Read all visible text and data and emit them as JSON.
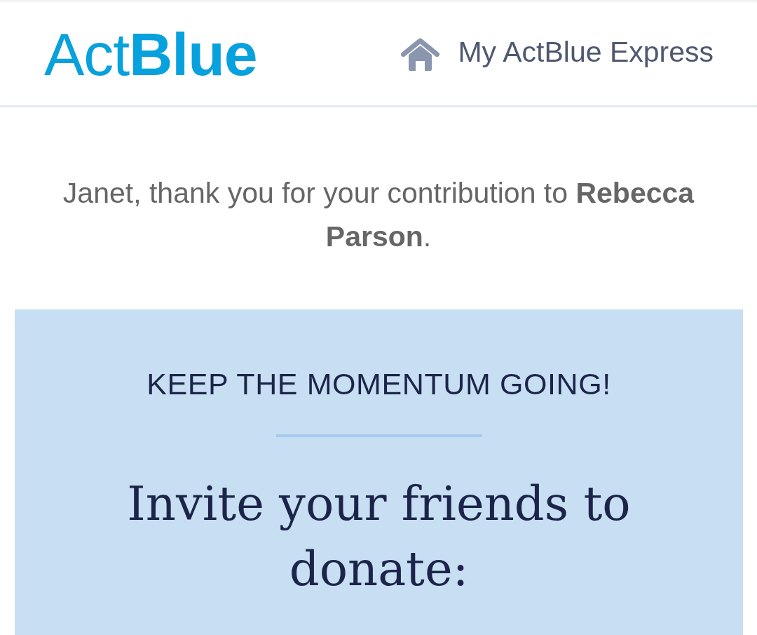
{
  "header": {
    "logo": "Act**Blue**",
    "nav_link": {
      "label": "My ActBlue Express"
    }
  },
  "thank_you": "Janet, thank you for your contribution to **Rebecca Parson**.",
  "promo": {
    "eyebrow": "KEEP THE MOMENTUM GOING!",
    "heading": "Invite your friends to donate:"
  }
}
